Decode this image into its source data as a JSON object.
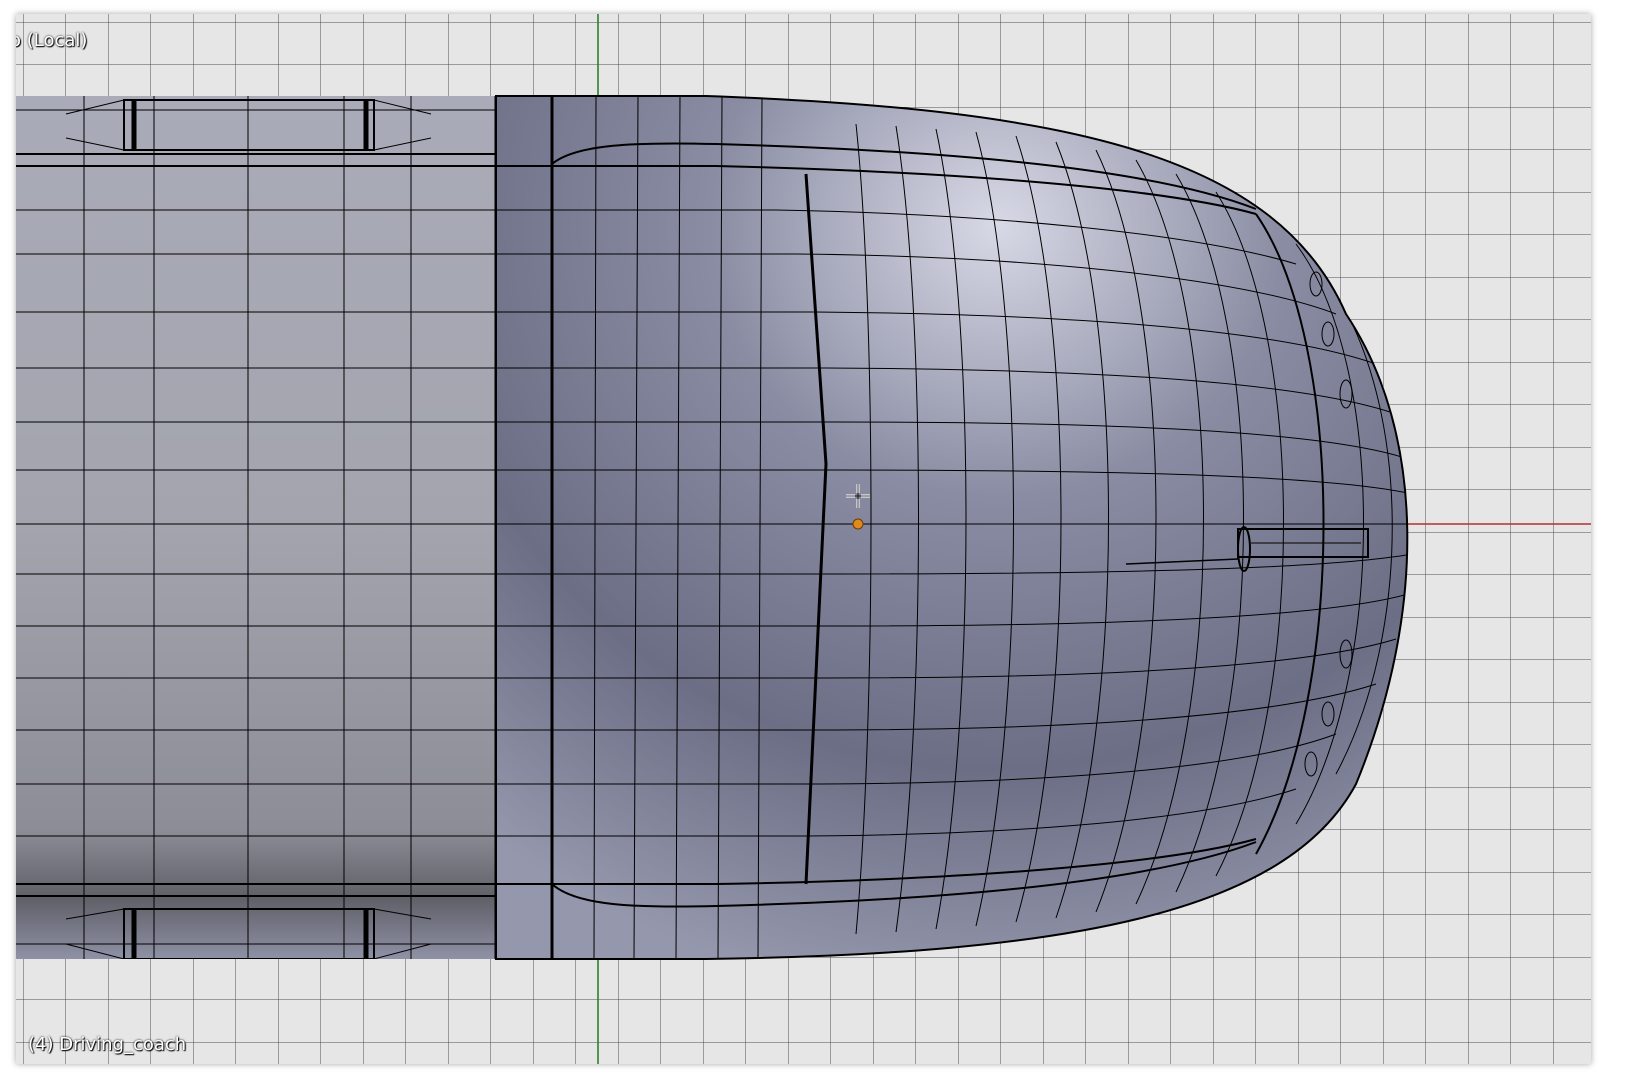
{
  "viewport": {
    "view_label": "o (Local)",
    "object_label": "(4) Driving_coach"
  },
  "colors": {
    "background": "#e6e6e6",
    "grid_line": "#4d4d4d",
    "y_axis": "#1e7a1e",
    "x_axis": "#b03030",
    "mesh_body": "#9ea0ae",
    "mesh_nose": "#7d7f95",
    "wire": "#000000",
    "origin_dot": "#e08a1e",
    "cursor": "#ffffff"
  },
  "icons": {
    "cursor": "3d-cursor-icon",
    "origin": "object-origin-icon"
  }
}
